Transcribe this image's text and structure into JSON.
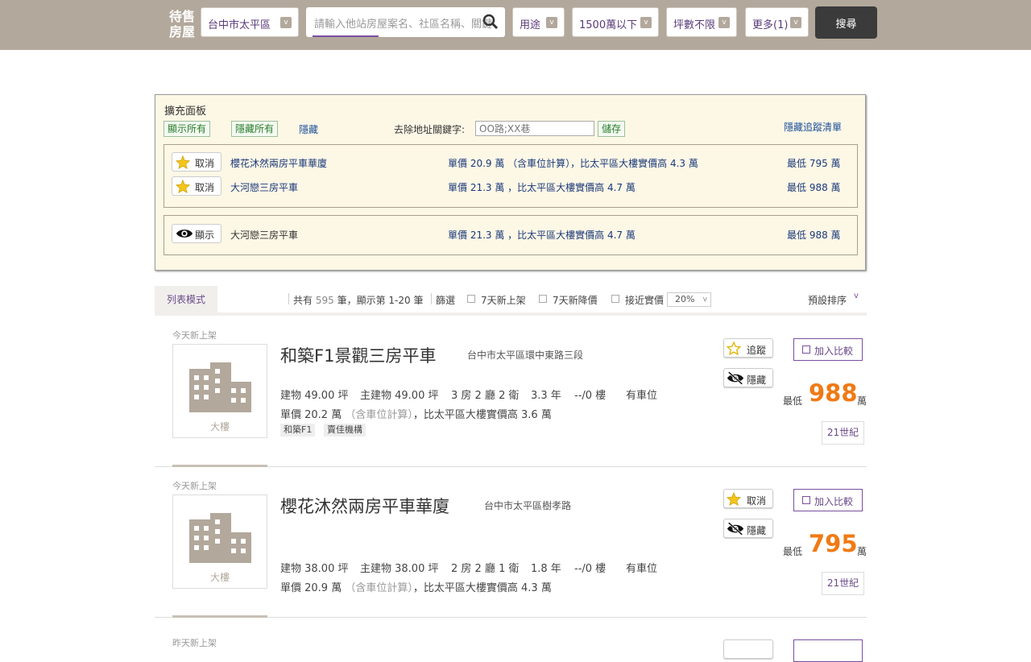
{
  "header": {
    "brand": "待售房屋",
    "district": "台中市太平區",
    "search_placeholder": "請輸入他站房屋案名、社區名稱、關鍵字",
    "usage": "用途",
    "price": "1500萬以下",
    "area": "坪數不限",
    "more": "更多(1)",
    "search_button": "搜尋",
    "dropdown_mark": "v"
  },
  "panel": {
    "title": "擴充面板",
    "show_all": "顯示所有",
    "hide_all": "隱藏所有",
    "hide": "隱藏",
    "keyword_label": "去除地址關鍵字:",
    "keyword_placeholder": "OO路;XX巷",
    "save": "儲存",
    "hide_tracking": "隱藏追蹤清單",
    "tracked": [
      {
        "button": "取消",
        "name": "櫻花沐然兩房平車華廈",
        "price": "單價 20.9 萬 （含車位計算），比太平區大樓實價高 4.3 萬",
        "low": "最低 795 萬"
      },
      {
        "button": "取消",
        "name": "大河戀三房平車",
        "price": "單價 21.3 萬 ，比太平區大樓實價高 4.7 萬",
        "low": "最低 988 萬"
      }
    ],
    "hidden": [
      {
        "button": "顯示",
        "name": "大河戀三房平車",
        "price": "單價 21.3 萬 ，比太平區大樓實價高 4.7 萬",
        "low": "最低 988 萬"
      }
    ]
  },
  "listbar": {
    "tab": "列表模式",
    "total_prefix": "共有",
    "total": "595",
    "total_suffix": "筆，顯示第",
    "range": "1-20",
    "range_suffix": "筆",
    "filter": "篩選",
    "new7": "7天新上架",
    "drop7": "7天新降價",
    "near": "接近實價",
    "pct": "20%",
    "sort": "預設排序"
  },
  "listings": [
    {
      "tag": "今天新上架",
      "thumb_label": "大樓",
      "title": "和築F1景觀三房平車",
      "address": "台中市太平區環中東路三段",
      "specs": [
        "建物 49.00 坪",
        "主建物 49.00 坪",
        "3 房 2 廳 2 衛",
        "3.3 年",
        "--/0 樓",
        "有車位"
      ],
      "unit_a": "單價 20.2 萬",
      "unit_b": "（含車位計算）",
      "unit_c": "，比太平區大樓實價高 3.6 萬",
      "chips": [
        "和築F1",
        "賣佳機構"
      ],
      "track": "追蹤",
      "hide": "隱藏",
      "compare": "加入比較",
      "low": "最低",
      "price": "988",
      "wan": "萬",
      "agent": "21世紀"
    },
    {
      "tag": "今天新上架",
      "thumb_label": "大樓",
      "title": "櫻花沐然兩房平車華廈",
      "address": "台中市太平區樹孝路",
      "specs": [
        "建物 38.00 坪",
        "主建物 38.00 坪",
        "2 房 2 廳 1 衛",
        "1.8 年",
        "--/0 樓",
        "有車位"
      ],
      "unit_a": "單價 20.9 萬",
      "unit_b": "（含車位計算）",
      "unit_c": "，比太平區大樓實價高 4.3 萬",
      "chips": [],
      "track": "取消",
      "hide": "隱藏",
      "compare": "加入比較",
      "low": "最低",
      "price": "795",
      "wan": "萬",
      "agent": "21世紀"
    },
    {
      "tag": "昨天新上架"
    }
  ]
}
